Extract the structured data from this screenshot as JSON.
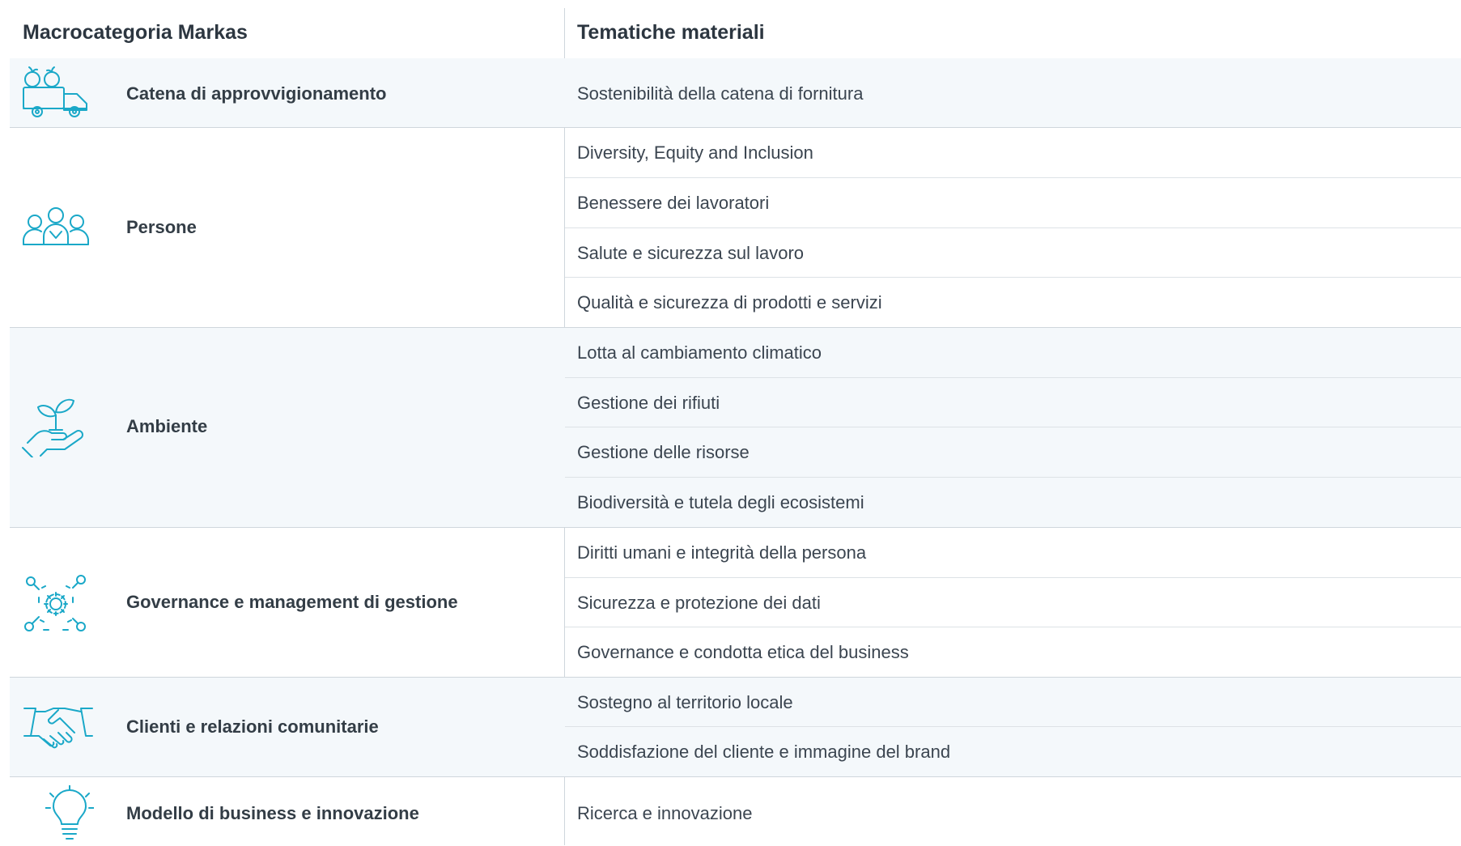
{
  "header": {
    "col1": "Macrocategoria Markas",
    "col2": "Tematiche materiali"
  },
  "groups": [
    {
      "label": "Catena di approvvigionamento",
      "icon": "supply-truck-icon",
      "topics": [
        "Sostenibilità della catena di fornitura"
      ]
    },
    {
      "label": "Persone",
      "icon": "people-group-icon",
      "topics": [
        "Diversity, Equity and Inclusion",
        "Benessere dei lavoratori",
        "Salute e sicurezza sul lavoro",
        "Qualità e sicurezza di prodotti e servizi"
      ]
    },
    {
      "label": "Ambiente",
      "icon": "hand-plant-icon",
      "topics": [
        "Lotta al cambiamento climatico",
        "Gestione dei rifiuti",
        "Gestione delle risorse",
        "Biodiversità e tutela degli ecosistemi"
      ]
    },
    {
      "label": "Governance e management di gestione",
      "icon": "gear-network-icon",
      "topics": [
        "Diritti umani e integrità della persona",
        "Sicurezza e protezione dei dati",
        "Governance e condotta etica del business"
      ]
    },
    {
      "label": "Clienti e relazioni comunitarie",
      "icon": "handshake-icon",
      "topics": [
        "Sostegno al territorio locale",
        "Soddisfazione del cliente e immagine del brand"
      ]
    },
    {
      "label": "Modello di business e innovazione",
      "icon": "lightbulb-icon",
      "topics": [
        "Ricerca e innovazione"
      ]
    }
  ],
  "colors": {
    "accent_icon": "#1aa8c8",
    "row_shade": "#f4f8fb",
    "divider": "#cfd6dc",
    "text": "#333d46"
  }
}
